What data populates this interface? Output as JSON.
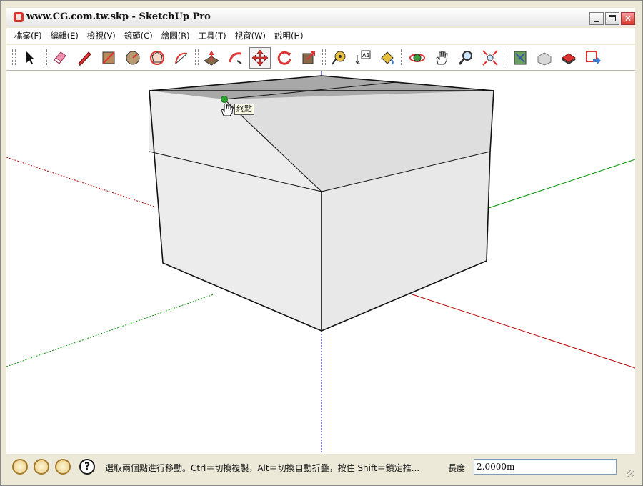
{
  "window": {
    "title": "www.CG.com.tw.skp - SketchUp Pro",
    "close_glyph": "✕"
  },
  "menu": [
    "檔案(F)",
    "編輯(E)",
    "檢視(V)",
    "鏡頭(C)",
    "繪圖(R)",
    "工具(T)",
    "視窗(W)",
    "說明(H)"
  ],
  "toolbar": {
    "tools": [
      {
        "icon": "select-arrow-icon"
      },
      {
        "icon": "eraser-icon"
      },
      {
        "icon": "pencil-line-icon"
      },
      {
        "icon": "rectangle-icon"
      },
      {
        "icon": "circle-icon"
      },
      {
        "icon": "polygon-icon"
      },
      {
        "icon": "arc-icon"
      },
      {
        "icon": "push-pull-icon"
      },
      {
        "icon": "follow-me-icon"
      },
      {
        "icon": "move-icon",
        "active": true
      },
      {
        "icon": "rotate-icon"
      },
      {
        "icon": "scale-icon"
      },
      {
        "icon": "tape-measure-icon"
      },
      {
        "icon": "text-label-icon",
        "text": "A1"
      },
      {
        "icon": "paint-bucket-icon"
      },
      {
        "icon": "orbit-icon"
      },
      {
        "icon": "pan-hand-icon"
      },
      {
        "icon": "zoom-icon"
      },
      {
        "icon": "zoom-extents-icon"
      },
      {
        "icon": "google-earth-icon"
      },
      {
        "icon": "3d-warehouse-icon"
      },
      {
        "icon": "share-model-icon"
      },
      {
        "icon": "get-models-icon"
      }
    ]
  },
  "viewport": {
    "inference_tooltip": "終點",
    "colors": {
      "x_axis": "#b40000",
      "y_axis": "#009100",
      "z_axis": "#0000b4",
      "face_light": "#ececec",
      "face_side": "#e8e8e8",
      "face_top_gray": "#a8a8a8",
      "face_sloped": "#dedede",
      "endpoint": "#2fa531"
    }
  },
  "statusbar": {
    "icons": [
      "tip-icon-1",
      "tip-icon-2",
      "tip-icon-3",
      "help-icon"
    ],
    "help_glyph": "?",
    "message": "選取兩個點進行移動。Ctrl＝切換複製，Alt＝切換自動折疊，按住 Shift＝鎖定推...",
    "measure_label": "長度",
    "measure_value": "2.0000m"
  }
}
